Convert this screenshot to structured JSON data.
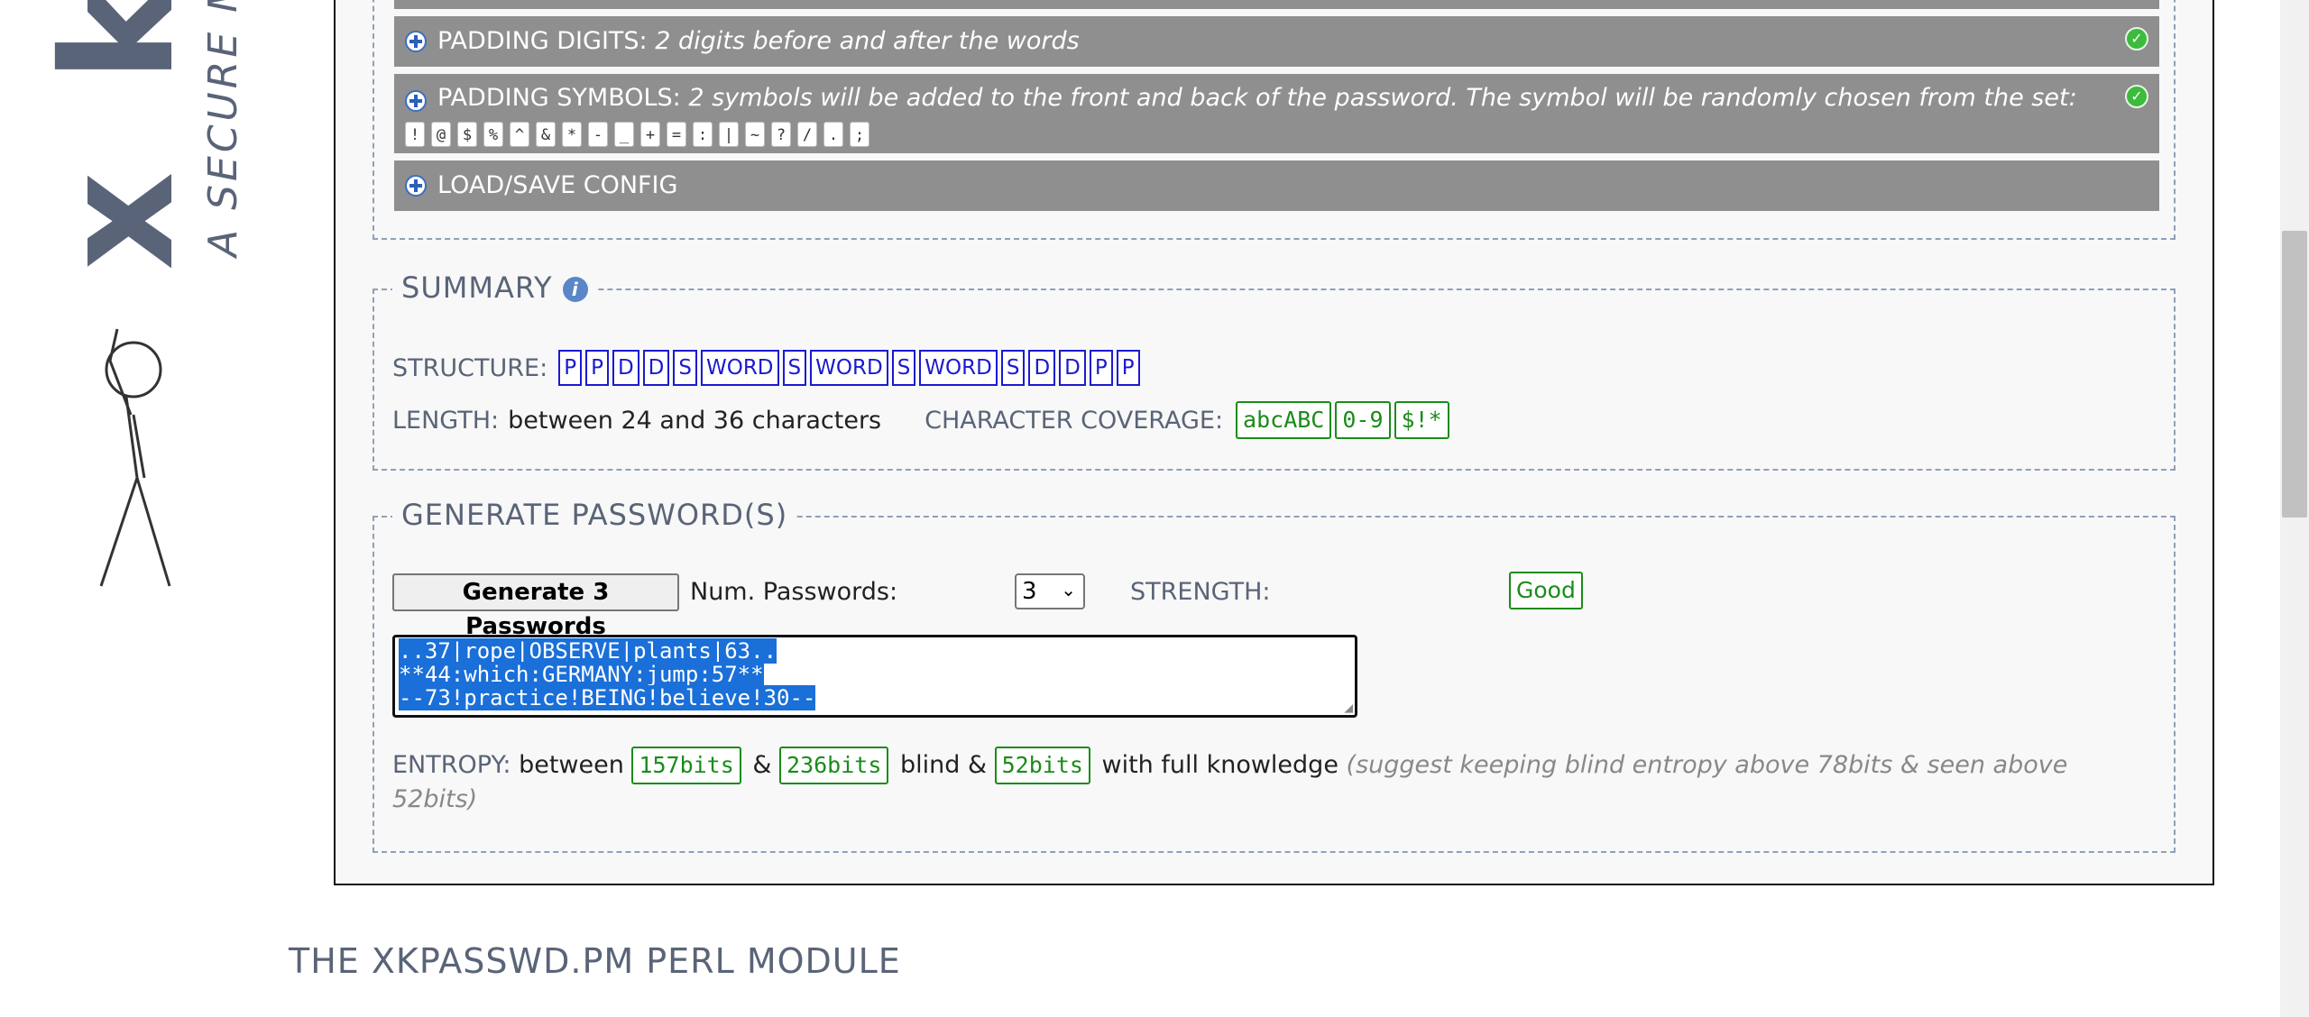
{
  "brand": {
    "logo_letters": "x k p",
    "tagline": "A SECURE ME"
  },
  "config_sections": {
    "padding_digits": {
      "label": "PADDING DIGITS:",
      "description": "2 digits before and after the words"
    },
    "padding_symbols": {
      "label": "PADDING SYMBOLS:",
      "description": "2 symbols will be added to the front and back of the password. The symbol will be randomly chosen from the set:",
      "symbols": [
        "!",
        "@",
        "$",
        "%",
        "^",
        "&",
        "*",
        "-",
        "_",
        "+",
        "=",
        ":",
        "|",
        "~",
        "?",
        "/",
        ".",
        ";"
      ]
    },
    "load_save": {
      "label": "LOAD/SAVE CONFIG"
    }
  },
  "summary": {
    "title": "SUMMARY",
    "structure_label": "STRUCTURE:",
    "structure_tokens": [
      "P",
      "P",
      "D",
      "D",
      "S",
      "WORD",
      "S",
      "WORD",
      "S",
      "WORD",
      "S",
      "D",
      "D",
      "P",
      "P"
    ],
    "length_label": "LENGTH:",
    "length_value": "between 24 and 36 characters",
    "coverage_label": "CHARACTER COVERAGE:",
    "coverage_tokens": [
      "abcABC",
      "0-9",
      "$!*"
    ]
  },
  "generate": {
    "title": "GENERATE PASSWORD(S)",
    "button_label": "Generate 3 Passwords",
    "num_label": "Num. Passwords:",
    "num_value": "3",
    "strength_label": "STRENGTH:",
    "strength_value": "Good",
    "passwords": [
      "..37|rope|OBSERVE|plants|63..",
      "**44:which:GERMANY:jump:57**",
      "--73!practice!BEING!believe!30--"
    ],
    "entropy_label": "ENTROPY:",
    "entropy_text_1": "between",
    "entropy_min": "157bits",
    "entropy_amp": "&",
    "entropy_max": "236bits",
    "entropy_text_2": "blind &",
    "entropy_seen": "52bits",
    "entropy_text_3": "with full knowledge",
    "entropy_suggestion": "(suggest keeping blind entropy above 78bits & seen above 52bits)"
  },
  "footer": {
    "title": "THE XKPASSWD.PM PERL MODULE"
  },
  "colors": {
    "bar_gray": "#8f8f8f",
    "token_blue": "#1a1ad0",
    "token_green": "#1a8c1a",
    "selection": "#1a6fd8"
  }
}
